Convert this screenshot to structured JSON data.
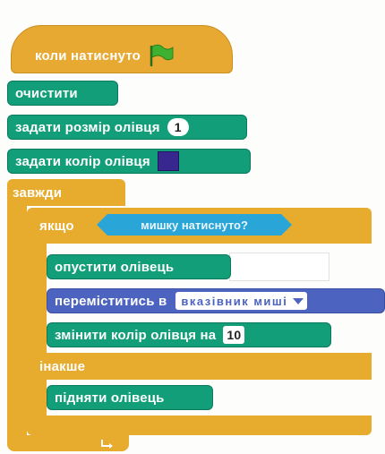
{
  "colors": {
    "events": "#e8a933",
    "pen": "#119e78",
    "control": "#e7ab2d",
    "motion": "#4c64bf",
    "sensing": "#2aa5d8",
    "pen_color_swatch": "#38278e",
    "flag": "#3fb02f"
  },
  "hat": {
    "label": "коли натиснуто",
    "icon": "green-flag-icon"
  },
  "blocks": {
    "clear": "очистити",
    "set_pen_size": "задати розмір олівця",
    "set_pen_size_value": "1",
    "set_pen_color": "задати колір олівця",
    "forever": "завжди",
    "if": "якщо",
    "condition": "мишку натиснуто?",
    "pen_down": "опустити олівець",
    "go_to": "переміститись в",
    "go_to_target": "вказівник миші",
    "change_pen_color": "змінити колір олівця на",
    "change_pen_color_value": "10",
    "else": "інакше",
    "pen_up": "підняти олівець"
  }
}
